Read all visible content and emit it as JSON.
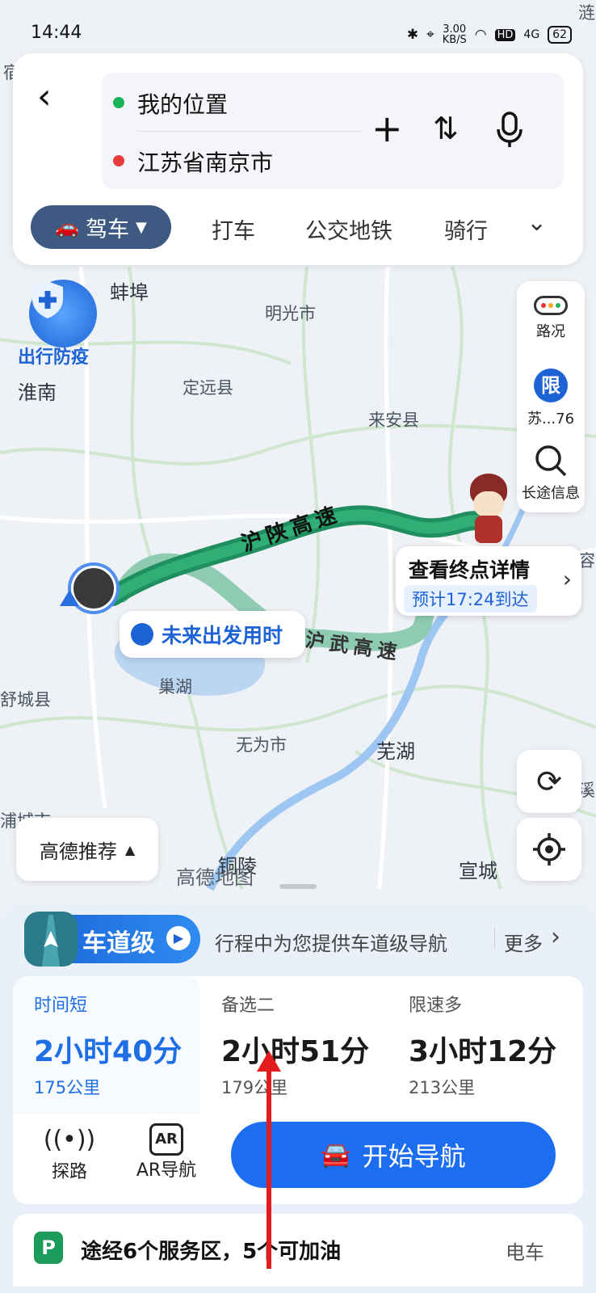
{
  "status_bar": {
    "time": "14:44",
    "net_speed": "3.00",
    "net_unit": "KB/S",
    "hd": "HD",
    "signal": "4G",
    "battery": "62"
  },
  "search": {
    "origin": "我的位置",
    "destination": "江苏省南京市"
  },
  "modes": {
    "drive": "驾车",
    "taxi": "打车",
    "transit": "公交地铁",
    "ride": "骑行"
  },
  "map": {
    "labels": {
      "bengbu": "蚌埠",
      "mingguang": "明光市",
      "huainan": "淮南",
      "dingyuan": "定远县",
      "laian": "来安县",
      "chaohu": "巢湖",
      "wuwei": "无为市",
      "wuhu": "芜湖",
      "shucheng": "舒城县",
      "tongling": "铜陵",
      "xuancheng": "宣城",
      "hucheng": "浦城市",
      "xi": "溪",
      "rong": "容",
      "top_right": "涟",
      "top_left": "宿"
    },
    "highway_1": "沪陕高速",
    "highway_2": "沪武高速",
    "watermark": "高德地图",
    "epidemic_badge": "出行防疫",
    "future_depart": "未来出发用时",
    "dest_title": "查看终点详情",
    "dest_eta": "预计17:24到达"
  },
  "side_panel": {
    "traffic": "路况",
    "restrict_icon": "限",
    "restrict_text": "苏...76",
    "long_trip": "长途信息"
  },
  "recommend": "高德推荐",
  "lane": {
    "pill": "车道级",
    "desc": "行程中为您提供车道级导航",
    "more": "更多"
  },
  "routes": [
    {
      "label": "时间短",
      "duration": "2小时40分",
      "distance": "175公里"
    },
    {
      "label": "备选二",
      "duration": "2小时51分",
      "distance": "179公里"
    },
    {
      "label": "限速多",
      "duration": "3小时12分",
      "distance": "213公里"
    }
  ],
  "tools": {
    "explore": "探路",
    "ar_icon": "AR",
    "ar": "AR导航"
  },
  "start_nav": "开始导航",
  "service": {
    "text": "途经6个服务区，5个可加油",
    "right": "电车",
    "icon": "P"
  }
}
